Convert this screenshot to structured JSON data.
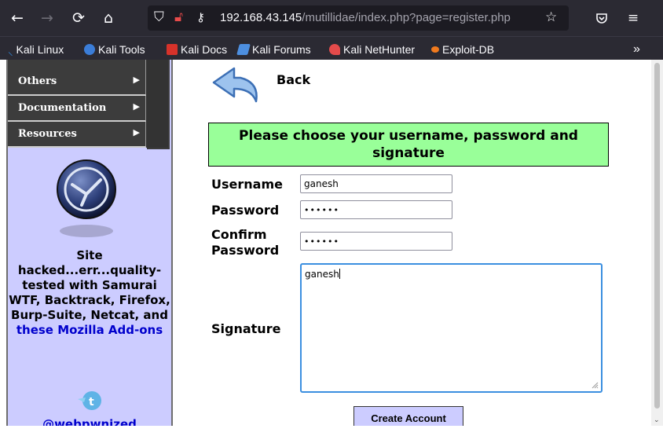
{
  "browser": {
    "url_host": "192.168.43.145",
    "url_path": "/mutillidae/index.php?page=register.php",
    "bookmarks": [
      {
        "label": "Kali Linux",
        "icon": "kali-dragon-icon",
        "color": "#2f8ae0"
      },
      {
        "label": "Kali Tools",
        "icon": "kali-tools-icon",
        "color": "#3b7dd8"
      },
      {
        "label": "Kali Docs",
        "icon": "kali-docs-icon",
        "color": "#d7322a"
      },
      {
        "label": "Kali Forums",
        "icon": "kali-forums-icon",
        "color": "#4d8fe0"
      },
      {
        "label": "Kali NetHunter",
        "icon": "nethunter-icon",
        "color": "#e44b4b"
      },
      {
        "label": "Exploit-DB",
        "icon": "exploit-db-icon",
        "color": "#f07a1e"
      }
    ],
    "overflow_label": "»"
  },
  "sidebar": {
    "menu": [
      {
        "label": "Others"
      },
      {
        "label": "Documentation"
      },
      {
        "label": "Resources"
      }
    ],
    "site_text_before": "Site hacked...err...quality-tested with Samurai WTF, Backtrack, Firefox, Burp-Suite, Netcat, and ",
    "site_text_link": "these Mozilla Add-ons",
    "twitter_handle": "@webpwnized"
  },
  "main": {
    "back_label": "Back",
    "heading": "Please choose your username, password and signature",
    "form": {
      "username_label": "Username",
      "username_value": "ganesh",
      "password_label": "Password",
      "password_value": "••••••",
      "confirm_label_line1": "Confirm",
      "confirm_label_line2": "Password",
      "confirm_value": "••••••",
      "signature_label": "Signature",
      "signature_value": "ganesh",
      "submit_label": "Create Account"
    }
  },
  "colors": {
    "chrome_bg": "#2b2a33",
    "sidebar_bg": "#ccccff",
    "heading_bg": "#99ff99",
    "link": "#0000cc",
    "focus": "#3b8fe0"
  }
}
